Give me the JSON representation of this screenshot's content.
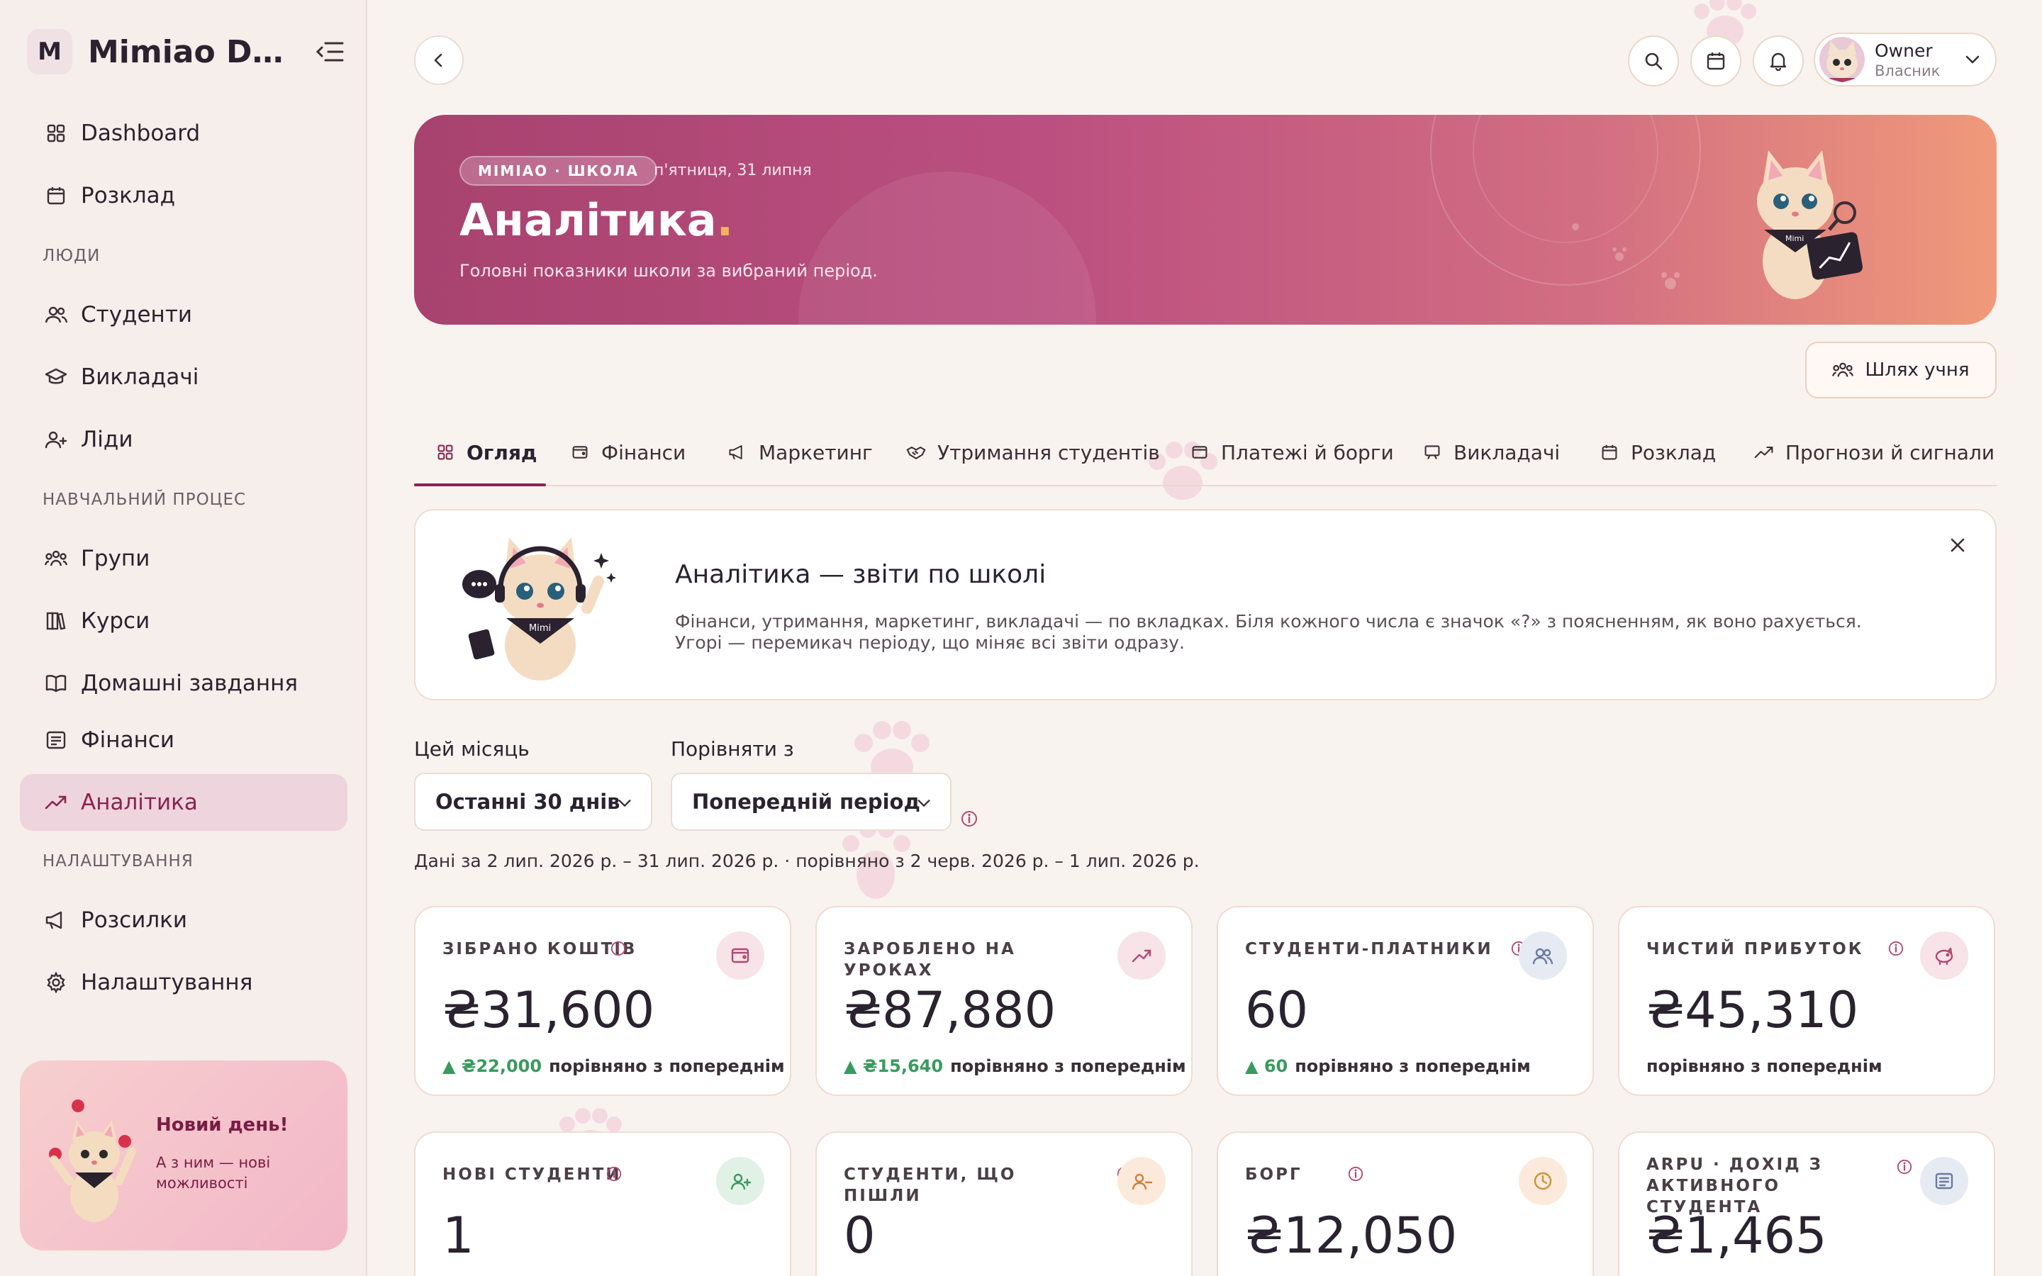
{
  "sidebar": {
    "brand_letter": "M",
    "brand_name": "Mimiao De...",
    "items": {
      "dashboard": "Dashboard",
      "schedule": "Розклад",
      "students": "Студенти",
      "teachers": "Викладачі",
      "leads": "Ліди",
      "groups": "Групи",
      "courses": "Курси",
      "homework": "Домашні завдання",
      "finance": "Фінанси",
      "analytics": "Аналітика",
      "mailings": "Розсилки",
      "settings": "Налаштування"
    },
    "sections": {
      "people": "ЛЮДИ",
      "learning": "НАВЧАЛЬНИЙ ПРОЦЕС",
      "settings": "НАЛАШТУВАННЯ"
    },
    "active_item": "analytics",
    "promo": {
      "title": "Новий день!",
      "subtitle": "А з ним — нові можливості"
    }
  },
  "topbar": {
    "user_name": "Owner",
    "user_role": "Власник"
  },
  "hero": {
    "badge": "MIMIAO · ШКОЛА",
    "date": "п'ятниця, 31 липня",
    "title": "Аналітика",
    "title_dot": ".",
    "subtitle": "Головні показники школи за вибраний період.",
    "mascot_tag": "Mimi"
  },
  "path_button": "Шлях учня",
  "tabs": {
    "overview": "Огляд",
    "finance": "Фінанси",
    "marketing": "Маркетинг",
    "retention": "Утримання студентів",
    "payments": "Платежі й борги",
    "teachers": "Викладачі",
    "schedule": "Розклад",
    "forecasts": "Прогнози й сигнали",
    "active": "overview"
  },
  "info_card": {
    "title": "Аналітика — звіти по школі",
    "text": "Фінанси, утримання, маркетинг, викладачі — по вкладках. Біля кожного числа є значок «?» з поясненням, як воно рахується. Угорі — перемикач періоду, що міняє всі звіти одразу.",
    "mascot_tag": "Mimi"
  },
  "filters": {
    "period_label": "Цей місяць",
    "period_value": "Останні 30 днів",
    "compare_label": "Порівняти з",
    "compare_value": "Попередній період",
    "range_text": "Дані за 2 лип. 2026 р. – 31 лип. 2026 р. · порівняно з 2 черв. 2026 р. – 1 лип. 2026 р."
  },
  "kpis": [
    {
      "label": "ЗІБРАНО КОШТІВ",
      "value": "₴31,600",
      "delta": "▲ ₴22,000",
      "compare": "порівняно з попереднім",
      "icon": "wallet-icon",
      "tint": "#f7e3e8",
      "stroke": "#b04a72"
    },
    {
      "label": "ЗАРОБЛЕНО НА УРОКАХ",
      "value": "₴87,880",
      "delta": "▲ ₴15,640",
      "compare": "порівняно з попереднім",
      "icon": "trend-up-icon",
      "tint": "#f7e3e8",
      "stroke": "#b04a72"
    },
    {
      "label": "СТУДЕНТИ-ПЛАТНИКИ",
      "value": "60",
      "delta": "▲ 60",
      "compare": "порівняно з попереднім",
      "icon": "users-icon",
      "tint": "#e6ebf3",
      "stroke": "#6a7aa0"
    },
    {
      "label": "ЧИСТИЙ ПРИБУТОК",
      "value": "₴45,310",
      "delta": "",
      "compare": "порівняно з попереднім",
      "icon": "piggy-bank-icon",
      "tint": "#f7e3e8",
      "stroke": "#b04a72"
    },
    {
      "label": "НОВІ СТУДЕНТИ",
      "value": "1",
      "delta": "",
      "compare": "",
      "icon": "user-plus-icon",
      "tint": "#e2f1e6",
      "stroke": "#3a9a5e"
    },
    {
      "label": "СТУДЕНТИ, ЩО ПІШЛИ",
      "value": "0",
      "delta": "",
      "compare": "",
      "icon": "user-minus-icon",
      "tint": "#fbeadb",
      "stroke": "#d0803a"
    },
    {
      "label": "БОРГ",
      "value": "₴12,050",
      "delta": "",
      "compare": "",
      "icon": "clock-icon",
      "tint": "#fbeadb",
      "stroke": "#d0903a"
    },
    {
      "label": "ARPU · ДОХІД З АКТИВНОГО СТУДЕНТА",
      "value": "₴1,465",
      "delta": "",
      "compare": "",
      "icon": "receipt-icon",
      "tint": "#e6ebf3",
      "stroke": "#6a7aa0"
    }
  ],
  "colors": {
    "accent": "#8a2350",
    "active_nav_bg": "#eed4dd",
    "positive": "#3a9a5e",
    "hero_start": "#a8426f",
    "hero_end": "#f09a7a"
  }
}
